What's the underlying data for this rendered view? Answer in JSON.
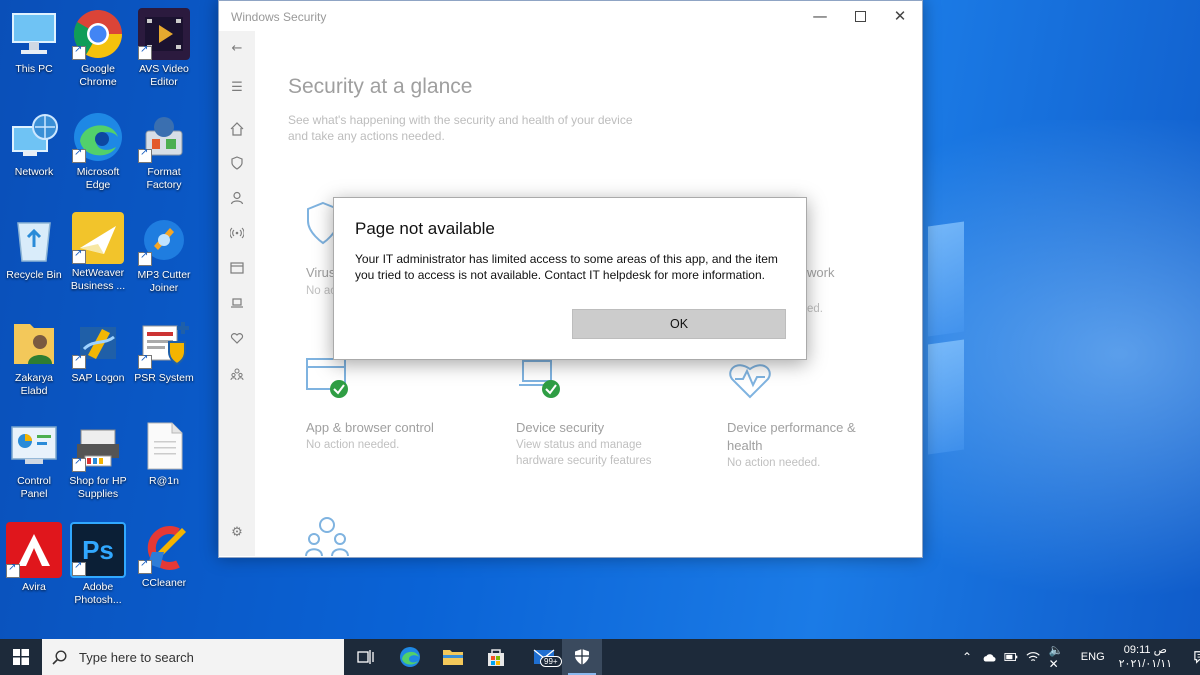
{
  "desktop": {
    "icons": [
      {
        "label": "This PC"
      },
      {
        "label": "Google Chrome"
      },
      {
        "label": "AVS Video Editor"
      },
      {
        "label": "Network"
      },
      {
        "label": "Microsoft Edge"
      },
      {
        "label": "Format Factory"
      },
      {
        "label": "Recycle Bin"
      },
      {
        "label": "NetWeaver Business ..."
      },
      {
        "label": "MP3 Cutter Joiner"
      },
      {
        "label": "Zakarya Elabd"
      },
      {
        "label": "SAP Logon"
      },
      {
        "label": "PSR System"
      },
      {
        "label": "Control Panel"
      },
      {
        "label": "Shop for HP Supplies"
      },
      {
        "label": "R@1n"
      },
      {
        "label": "Avira"
      },
      {
        "label": "Adobe Photosh..."
      },
      {
        "label": "CCleaner"
      }
    ]
  },
  "window": {
    "title": "Windows Security",
    "page_title": "Security at a glance",
    "page_subtitle": "See what's happening with the security and health of your device and take any actions needed.",
    "tiles": [
      {
        "title": "Virus",
        "status": "No ac"
      },
      {
        "title": "work",
        "status": "ed."
      },
      {
        "title": "App & browser control",
        "status": "No action needed."
      },
      {
        "title": "Device security",
        "status": "View status and manage hardware security features"
      },
      {
        "title": "Device performance & health",
        "status": "No action needed."
      }
    ]
  },
  "dialog": {
    "title": "Page not available",
    "message": "Your IT administrator has limited access to some areas of this app, and the item you tried to access is not available. Contact IT helpdesk for more information.",
    "ok_label": "OK"
  },
  "taskbar": {
    "search_placeholder": "Type here to search",
    "mail_badge": "99+",
    "language": "ENG",
    "time": "09:11 ص",
    "date": "٢٠٢١/٠١/١١"
  },
  "colors": {
    "desktop_blue": "#0a63d6",
    "taskbar": "#1d2a3a",
    "dialog_button": "#cccccc",
    "check_green": "#2f9e44",
    "ws_icon_blue": "#7fb3e0"
  }
}
